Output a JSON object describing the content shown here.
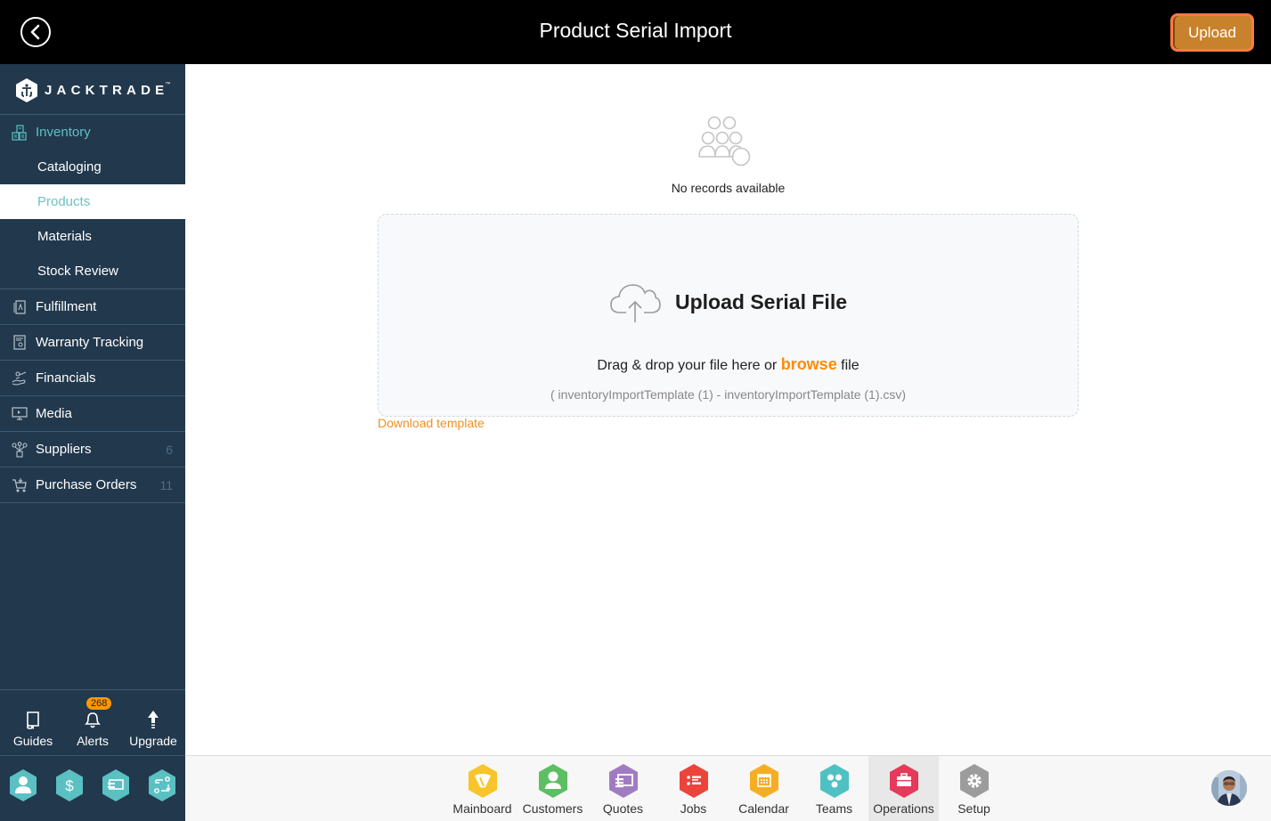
{
  "header": {
    "title": "Product Serial Import",
    "upload_label": "Upload",
    "back_icon": "chevron-left-circle-icon"
  },
  "brand": {
    "name": "JACKTRADE",
    "tm": "™"
  },
  "sidebar": {
    "section": {
      "label": "Inventory",
      "icon": "inventory-icon"
    },
    "sub_items": [
      {
        "label": "Cataloging",
        "active": false
      },
      {
        "label": "Products",
        "active": true
      },
      {
        "label": "Materials",
        "active": false
      },
      {
        "label": "Stock Review",
        "active": false
      }
    ],
    "items": [
      {
        "label": "Fulfillment",
        "icon": "fulfillment-icon",
        "count": ""
      },
      {
        "label": "Warranty Tracking",
        "icon": "warranty-icon",
        "count": ""
      },
      {
        "label": "Financials",
        "icon": "financials-icon",
        "count": ""
      },
      {
        "label": "Media",
        "icon": "media-icon",
        "count": ""
      },
      {
        "label": "Suppliers",
        "icon": "suppliers-icon",
        "count": "6"
      },
      {
        "label": "Purchase Orders",
        "icon": "purchase-orders-icon",
        "count": "11"
      }
    ],
    "utilities": [
      {
        "label": "Guides",
        "icon": "book-icon"
      },
      {
        "label": "Alerts",
        "icon": "bell-icon",
        "badge": "268"
      },
      {
        "label": "Upgrade",
        "icon": "arrow-up-icon"
      }
    ],
    "quick_actions": [
      {
        "name": "user-icon"
      },
      {
        "name": "dollar-icon"
      },
      {
        "name": "cash-icon"
      },
      {
        "name": "workflow-icon"
      }
    ]
  },
  "main": {
    "empty_state": "No records available",
    "upload_box": {
      "title": "Upload Serial File",
      "drag_text_before": "Drag & drop your file here or ",
      "browse_label": "browse",
      "drag_text_after": " file",
      "file_name": "( inventoryImportTemplate (1) - inventoryImportTemplate (1).csv)"
    },
    "download_template": "Download template"
  },
  "bottom_nav": {
    "apps": [
      {
        "label": "Mainboard",
        "color": "#f7c52b",
        "icon": "mainboard-icon",
        "active": false
      },
      {
        "label": "Customers",
        "color": "#5cbf62",
        "icon": "customer-icon",
        "active": false
      },
      {
        "label": "Quotes",
        "color": "#a17bc2",
        "icon": "quotes-icon",
        "active": false
      },
      {
        "label": "Jobs",
        "color": "#ec433b",
        "icon": "jobs-icon",
        "active": false
      },
      {
        "label": "Calendar",
        "color": "#f5ae24",
        "icon": "calendar-icon",
        "active": false
      },
      {
        "label": "Teams",
        "color": "#4fc1c3",
        "icon": "teams-icon",
        "active": false
      },
      {
        "label": "Operations",
        "color": "#e53a5a",
        "icon": "briefcase-icon",
        "active": true
      },
      {
        "label": "Setup",
        "color": "#9c9c9c",
        "icon": "gear-icon",
        "active": false
      }
    ]
  },
  "colors": {
    "sidebar_bg": "#22384d",
    "accent_teal": "#5bc2c4",
    "accent_orange": "#ff8c00",
    "upload_btn": "#c9822c"
  }
}
